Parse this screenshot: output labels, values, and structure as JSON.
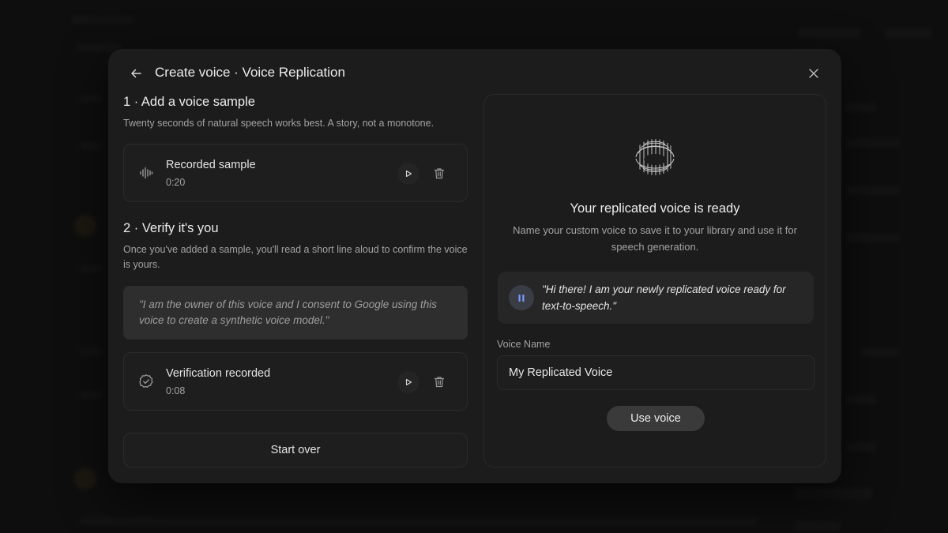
{
  "dialog": {
    "title": "Create voice · Voice Replication",
    "back_icon": "arrow-left-icon",
    "close_icon": "close-icon"
  },
  "step1": {
    "title": "1 · Add a voice sample",
    "description": "Twenty seconds of natural speech works best. A story, not a monotone.",
    "sample": {
      "icon": "waveform-icon",
      "title": "Recorded sample",
      "duration": "0:20"
    }
  },
  "step2": {
    "title": "2 · Verify it's you",
    "description": "Once you've added a sample, you'll read a short line aloud to confirm the voice is yours.",
    "consent_quote": "\"I am the owner of this voice and I consent to Google using this voice to create a synthetic voice model.\"",
    "verification": {
      "icon": "check-badge-icon",
      "title": "Verification recorded",
      "duration": "0:08"
    }
  },
  "start_over_label": "Start over",
  "result": {
    "title": "Your replicated voice is ready",
    "description": "Name your custom voice to save it to your library and use it for speech generation.",
    "preview_text": "\"Hi there! I am your newly replicated voice ready for text-to-speech.\"",
    "voice_name_label": "Voice Name",
    "voice_name_value": "My Replicated Voice",
    "use_voice_label": "Use voice"
  },
  "colors": {
    "dialog_bg": "#1c1c1c",
    "accent_pause": "#7b9cff"
  }
}
